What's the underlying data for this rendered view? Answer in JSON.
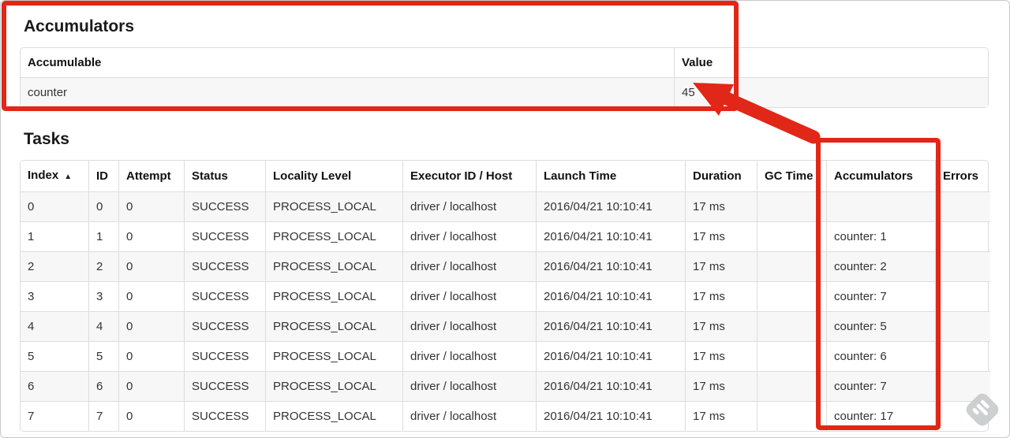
{
  "theme": {
    "annotation_color": "#e12717",
    "table_border_color": "#dddddd",
    "stripe_color": "#f7f7f7"
  },
  "accumulators_section": {
    "heading": "Accumulators",
    "table": {
      "columns": [
        "Accumulable",
        "Value"
      ],
      "rows": [
        [
          "counter",
          "45"
        ]
      ]
    }
  },
  "tasks_section": {
    "heading": "Tasks",
    "table": {
      "columns": [
        "Index",
        "ID",
        "Attempt",
        "Status",
        "Locality Level",
        "Executor ID / Host",
        "Launch Time",
        "Duration",
        "GC Time",
        "Accumulators",
        "Errors"
      ],
      "sort_indicator": "▲",
      "rows": [
        [
          "0",
          "0",
          "0",
          "SUCCESS",
          "PROCESS_LOCAL",
          "driver / localhost",
          "2016/04/21 10:10:41",
          "17 ms",
          "",
          "",
          ""
        ],
        [
          "1",
          "1",
          "0",
          "SUCCESS",
          "PROCESS_LOCAL",
          "driver / localhost",
          "2016/04/21 10:10:41",
          "17 ms",
          "",
          "counter: 1",
          ""
        ],
        [
          "2",
          "2",
          "0",
          "SUCCESS",
          "PROCESS_LOCAL",
          "driver / localhost",
          "2016/04/21 10:10:41",
          "17 ms",
          "",
          "counter: 2",
          ""
        ],
        [
          "3",
          "3",
          "0",
          "SUCCESS",
          "PROCESS_LOCAL",
          "driver / localhost",
          "2016/04/21 10:10:41",
          "17 ms",
          "",
          "counter: 7",
          ""
        ],
        [
          "4",
          "4",
          "0",
          "SUCCESS",
          "PROCESS_LOCAL",
          "driver / localhost",
          "2016/04/21 10:10:41",
          "17 ms",
          "",
          "counter: 5",
          ""
        ],
        [
          "5",
          "5",
          "0",
          "SUCCESS",
          "PROCESS_LOCAL",
          "driver / localhost",
          "2016/04/21 10:10:41",
          "17 ms",
          "",
          "counter: 6",
          ""
        ],
        [
          "6",
          "6",
          "0",
          "SUCCESS",
          "PROCESS_LOCAL",
          "driver / localhost",
          "2016/04/21 10:10:41",
          "17 ms",
          "",
          "counter: 7",
          ""
        ],
        [
          "7",
          "7",
          "0",
          "SUCCESS",
          "PROCESS_LOCAL",
          "driver / localhost",
          "2016/04/21 10:10:41",
          "17 ms",
          "",
          "counter: 17",
          ""
        ]
      ]
    }
  }
}
